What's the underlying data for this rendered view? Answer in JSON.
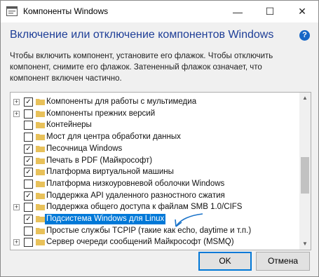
{
  "window": {
    "title": "Компоненты Windows",
    "controls": {
      "minimize": "—",
      "maximize": "☐",
      "close": "✕"
    }
  },
  "heading": "Включение или отключение компонентов Windows",
  "help_label": "?",
  "description": "Чтобы включить компонент, установите его флажок. Чтобы отключить компонент, снимите его флажок. Затененный флажок означает, что компонент включен частично.",
  "features": [
    {
      "label": "Компоненты для работы с мультимедиа",
      "expandable": true,
      "checked": true,
      "selected": false
    },
    {
      "label": "Компоненты прежних версий",
      "expandable": true,
      "checked": false,
      "selected": false
    },
    {
      "label": "Контейнеры",
      "expandable": false,
      "checked": false,
      "selected": false
    },
    {
      "label": "Мост для центра обработки данных",
      "expandable": false,
      "checked": false,
      "selected": false
    },
    {
      "label": "Песочница Windows",
      "expandable": false,
      "checked": true,
      "selected": false
    },
    {
      "label": "Печать в PDF (Майкрософт)",
      "expandable": false,
      "checked": true,
      "selected": false
    },
    {
      "label": "Платформа виртуальной машины",
      "expandable": false,
      "checked": true,
      "selected": false
    },
    {
      "label": "Платформа низкоуровневой оболочки Windows",
      "expandable": false,
      "checked": false,
      "selected": false
    },
    {
      "label": "Поддержка API удаленного разностного сжатия",
      "expandable": false,
      "checked": true,
      "selected": false
    },
    {
      "label": "Поддержка общего доступа к файлам SMB 1.0/CIFS",
      "expandable": true,
      "checked": false,
      "selected": false
    },
    {
      "label": "Подсистема Windows для Linux",
      "expandable": false,
      "checked": true,
      "selected": true
    },
    {
      "label": "Простые службы TCPIP (такие как echo, daytime и т.п.)",
      "expandable": false,
      "checked": false,
      "selected": false
    },
    {
      "label": "Сервер очереди сообщений Майкрософт (MSMQ)",
      "expandable": true,
      "checked": false,
      "selected": false
    }
  ],
  "glyphs": {
    "expander": "+",
    "check": "✓",
    "scroll_up": "▲",
    "scroll_down": "▼"
  },
  "buttons": {
    "ok": "OK",
    "cancel": "Отмена"
  },
  "colors": {
    "heading": "#1e3e97",
    "selection": "#0078d7",
    "folder": "#e8c15a",
    "arrow": "#1a73c9"
  }
}
